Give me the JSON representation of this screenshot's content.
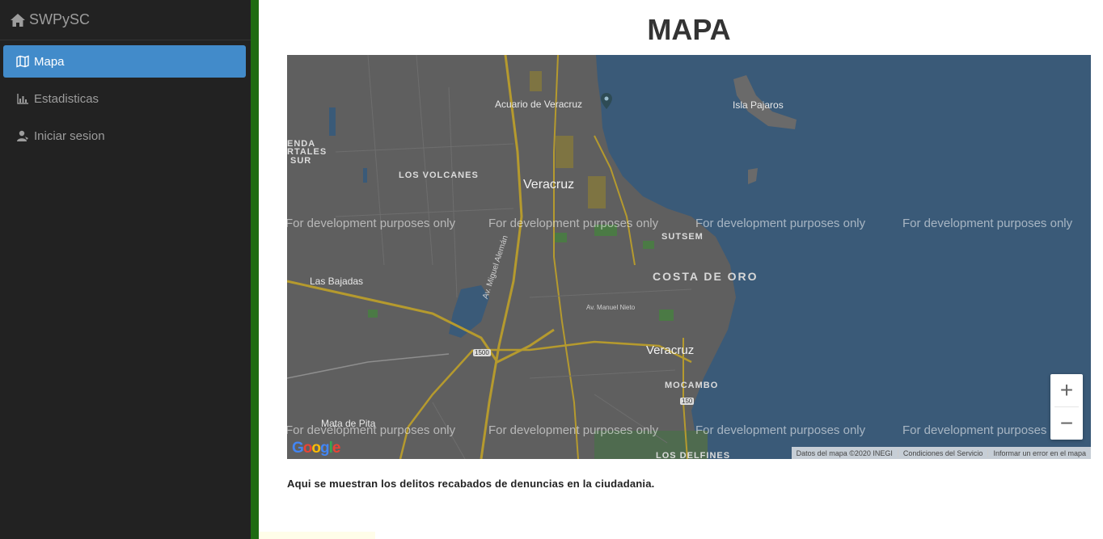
{
  "brand": {
    "name": "SWPySC",
    "icon": "home-icon"
  },
  "nav": [
    {
      "label": "Mapa",
      "icon": "map-icon",
      "active": true
    },
    {
      "label": "Estadisticas",
      "icon": "bar-chart-icon",
      "active": false
    },
    {
      "label": "Iniciar sesion",
      "icon": "user-icon",
      "active": false
    }
  ],
  "page": {
    "title": "MAPA",
    "caption": "Aqui se muestran los delitos recabados de denuncias en la ciudadania."
  },
  "map": {
    "labels": {
      "acuario": "Acuario de Veracruz",
      "isla": "Isla Pajaros",
      "veracruz_top": "Veracruz",
      "los_volcanes": "LOS VOLCANES",
      "sutsem": "SUTSEM",
      "costa_de_oro": "COSTA DE ORO",
      "las_bajadas": "Las Bajadas",
      "veracruz_bottom": "Veracruz",
      "mocambo": "MOCAMBO",
      "mata_de_pita": "Mata de Pita",
      "los_delfines": "LOS DELFINES",
      "enda": "ENDA",
      "rtales": "RTALES",
      "sur": "SUR",
      "av_miguel_aleman": "Av. Miguel Alemán",
      "av_manuel_nieto": "Av. Manuel Nieto",
      "shield_1500": "1500",
      "shield_150": "150"
    },
    "dev_watermark": "For development purposes only",
    "zoom_in": "+",
    "zoom_out": "−",
    "google": "Google",
    "attribution": {
      "data": "Datos del mapa ©2020 INEGI",
      "terms": "Condiciones del Servicio",
      "report": "Informar un error en el mapa"
    }
  },
  "colors": {
    "sidebar_bg": "#222222",
    "active_nav": "#428bca",
    "accent_bar": "#1e6b12",
    "sea": "#3a5a78",
    "land": "#5f5f5f",
    "road": "#b59a2e"
  }
}
